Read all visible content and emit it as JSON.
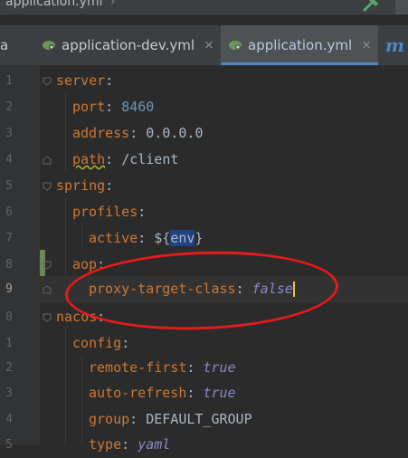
{
  "breadcrumb": {
    "file": "application.yml",
    "separator": "›"
  },
  "tabs": [
    {
      "label": "a",
      "closable": false
    },
    {
      "label": "application-dev.yml",
      "close": "×",
      "icon": "spring-leaf-icon"
    },
    {
      "label": "application.yml",
      "close": "×",
      "icon": "spring-leaf-icon",
      "active": true
    },
    {
      "label": "m",
      "icon": "maven-icon"
    }
  ],
  "colors": {
    "key": "#cc7832",
    "value": "#a9b7c6",
    "number": "#6897bb",
    "boolean": "#8888c6",
    "annotation": "#e31b1b",
    "tab_underline": "#4a88c7"
  },
  "lines": [
    {
      "num": "1",
      "key": "server",
      "sep": ":"
    },
    {
      "num": "2",
      "key": "port",
      "sep": ": ",
      "value": "8460"
    },
    {
      "num": "3",
      "key": "address",
      "sep": ": ",
      "value": "0.0.0.0"
    },
    {
      "num": "4",
      "key": "path",
      "sep": ": ",
      "value": "/client"
    },
    {
      "num": "5",
      "key": "spring",
      "sep": ":"
    },
    {
      "num": "6",
      "key": "profiles",
      "sep": ":"
    },
    {
      "num": "7",
      "key": "active",
      "sep": ": ",
      "value_pre": "${",
      "value_hl": "env",
      "value_post": "}"
    },
    {
      "num": "8",
      "key": "aop",
      "sep": ":"
    },
    {
      "num": "9",
      "key": "proxy-target-class",
      "sep": ": ",
      "value": "false"
    },
    {
      "num": "0",
      "key": "nacos",
      "sep": ":"
    },
    {
      "num": "1",
      "key": "config",
      "sep": ":"
    },
    {
      "num": "2",
      "key": "remote-first",
      "sep": ": ",
      "value": "true"
    },
    {
      "num": "3",
      "key": "auto-refresh",
      "sep": ": ",
      "value": "true"
    },
    {
      "num": "4",
      "key": "group",
      "sep": ": ",
      "value": "DEFAULT_GROUP"
    },
    {
      "num": "5",
      "key": "type",
      "sep": ": ",
      "value": "yaml"
    }
  ]
}
